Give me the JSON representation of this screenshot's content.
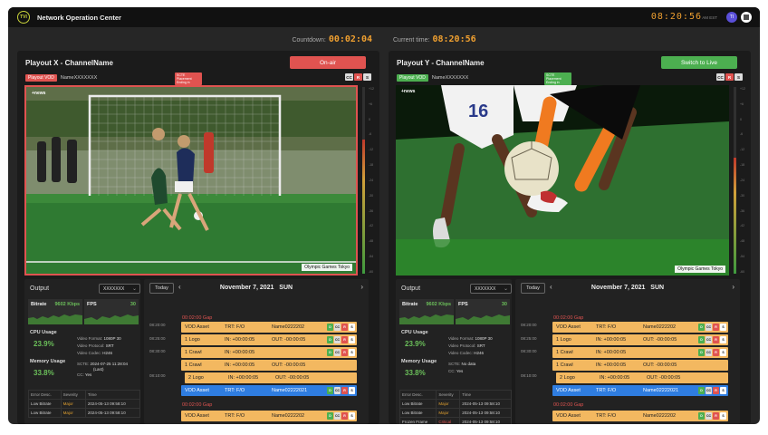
{
  "app": {
    "title": "Network Operation Center",
    "logo_text": "TVI",
    "clock": "08:20:56",
    "clock_tz": "AM EST",
    "avatar": "TI"
  },
  "timing": {
    "countdown_label": "Countdown:",
    "countdown": "00:02:04",
    "current_label": "Current time:",
    "current": "08:20:56"
  },
  "colors": {
    "accent": "#f0a030",
    "onair": "#e05350",
    "live": "#4caf50",
    "block": "#f3b860",
    "block_active": "#2f7de0"
  },
  "left": {
    "title": "Playout X - ChannelName",
    "button": "On-air",
    "tag": "Playout VOD",
    "tag_name": "NameXXXXXXX",
    "scte": "SCTE Placement Ending in",
    "cc": [
      "CC",
      "R",
      "S"
    ],
    "video_tag": "+news",
    "caption": "Olympic Games Tokyo",
    "audio_level": 0.72,
    "output": {
      "label": "Output",
      "select": "XXXXXXX",
      "bitrate_label": "Bitrate",
      "bitrate": "9602 Kbps",
      "fps_label": "FPS",
      "fps": "30",
      "cpu_label": "CPU Usage",
      "cpu": "23.9%",
      "mem_label": "Memory Usage",
      "mem": "33.8%",
      "format": "1080P 30",
      "protocol": "SRT",
      "codec": "H246",
      "scte": "2024-07-25 11:28:04",
      "scte_sub": "(Last)",
      "cc": "Yes",
      "errors": [
        {
          "desc": "Low Bitrate",
          "sev": "Major",
          "time": "2024-05-13 09:58:10"
        },
        {
          "desc": "Low Bitrate",
          "sev": "Major",
          "time": "2024-05-13 09:58:10"
        }
      ]
    }
  },
  "right": {
    "title": "Playout Y - ChannelName",
    "button": "Switch to Live",
    "tag": "Playout VOD",
    "tag_name": "NameXXXXXXX",
    "scte": "SCTE Placement Ending in",
    "cc": [
      "CC",
      "R",
      "S"
    ],
    "video_tag": "+news",
    "caption": "Olympic Games Tokyo",
    "audio_level": 0.62,
    "output": {
      "label": "Output",
      "select": "XXXXXXX",
      "bitrate_label": "Bitrate",
      "bitrate": "9602 Kbps",
      "fps_label": "FPS",
      "fps": "30",
      "cpu_label": "CPU Usage",
      "cpu": "23.9%",
      "mem_label": "Memory Usage",
      "mem": "33.8%",
      "format": "1080P 30",
      "protocol": "SRT",
      "codec": "H246",
      "scte": "No data",
      "scte_sub": "",
      "cc": "Yes",
      "errors": [
        {
          "desc": "Low Bitrate",
          "sev": "Major",
          "time": "2024-05-13 09:58:10"
        },
        {
          "desc": "Low Bitrate",
          "sev": "Major",
          "time": "2024-05-13 09:58:10"
        },
        {
          "desc": "Frozen Frame",
          "sev": "Critical",
          "time": "2024-05-13 09:58:10"
        }
      ]
    }
  },
  "labels": {
    "video_format": "Video Format:",
    "video_protocol": "Video Protocol:",
    "video_codec": "Video Codec:",
    "scte": "SCTE:",
    "cc": "CC:",
    "err_desc": "Error Desc.",
    "err_sev": "Severity",
    "err_time": "Time",
    "meter_ticks": [
      "+12",
      "+6",
      "0",
      "-6",
      "-12",
      "-18",
      "-24",
      "-30",
      "-36",
      "-42",
      "-48",
      "-54",
      "-60"
    ]
  },
  "schedule": {
    "today": "Today",
    "date": "November 7, 2021",
    "day": "SUN",
    "times": [
      "08:20:00",
      "08:25:00",
      "08:30:00",
      "08:10:00"
    ],
    "gap": "00:02:00 Gap",
    "blocks": [
      {
        "type": "VOD Asset",
        "mid": "TRT: F/O",
        "right": "Name0222202",
        "tags": true
      },
      {
        "type": "1 Logo",
        "mid": "IN: +00:00:05",
        "right": "OUT: -00:00:05",
        "tags": true
      },
      {
        "type": "1 Crawl",
        "mid": "IN: +00:00:05",
        "right": "",
        "tags": true
      },
      {
        "type": "1 Crawl",
        "mid": "IN: +00:00:05",
        "right": "OUT: -00:00:05",
        "tags": false
      },
      {
        "type": "2 Logo",
        "mid": "IN: +00:00:05",
        "right": "OUT: -00:00:05",
        "tags": false
      },
      {
        "type": "VOD Asset",
        "mid": "TRT: F/O",
        "right": "Name02222021",
        "tags": true
      }
    ],
    "gap2": "00:02:00 Gap",
    "next": {
      "type": "VOD Asset",
      "mid": "TRT: F/O",
      "right": "Name0222202"
    },
    "tag_letters": [
      "D",
      "CC",
      "R",
      "S"
    ]
  }
}
